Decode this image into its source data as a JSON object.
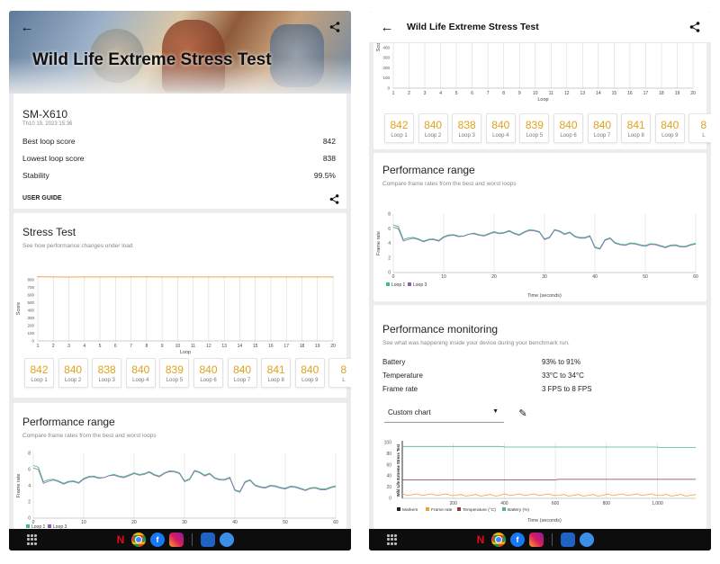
{
  "app": {
    "title": "Wild Life Extreme Stress Test",
    "back_icon": "arrow-left-icon",
    "share_icon": "share-icon"
  },
  "device": {
    "name": "SM-X610",
    "date": "Th10 19, 2023 15:36"
  },
  "summary": {
    "best_label": "Best loop score",
    "best_value": "842",
    "lowest_label": "Lowest loop score",
    "lowest_value": "838",
    "stability_label": "Stability",
    "stability_value": "99.5%",
    "user_guide": "USER GUIDE"
  },
  "stress": {
    "title": "Stress Test",
    "subtitle": "See how performance changes under load",
    "ylabel": "Score",
    "xlabel": "Loop",
    "ticks_left": [
      "800",
      "700",
      "600",
      "500",
      "400",
      "300",
      "200",
      "100",
      "0"
    ],
    "ticks_right": [
      "800",
      "700",
      "600",
      "500",
      "400",
      "300",
      "200",
      "100",
      "0"
    ]
  },
  "loops": [
    {
      "value": "842",
      "label": "Loop 1"
    },
    {
      "value": "840",
      "label": "Loop 2"
    },
    {
      "value": "838",
      "label": "Loop 3"
    },
    {
      "value": "840",
      "label": "Loop 4"
    },
    {
      "value": "839",
      "label": "Loop 5"
    },
    {
      "value": "840",
      "label": "Loop 6"
    },
    {
      "value": "840",
      "label": "Loop 7"
    },
    {
      "value": "841",
      "label": "Loop 8"
    },
    {
      "value": "840",
      "label": "Loop 9"
    },
    {
      "value": "8",
      "label": "L"
    }
  ],
  "perf_range": {
    "title": "Performance range",
    "subtitle": "Compare frame rates from the best and worst loops",
    "ylabel": "Frame rate",
    "xlabel": "Time (seconds)",
    "yticks": [
      "8",
      "6",
      "4",
      "2",
      "0"
    ],
    "xticks": [
      "0",
      "10",
      "20",
      "30",
      "40",
      "50",
      "60"
    ],
    "legend": [
      "Loop 1",
      "Loop 3"
    ],
    "colors": {
      "loop1": "#3dbf7a",
      "loop3": "#8a5fb5"
    }
  },
  "monitoring": {
    "title": "Performance monitoring",
    "subtitle": "See what was happening inside your device during your benchmark run.",
    "rows": [
      {
        "label": "Battery",
        "value": "93% to 91%"
      },
      {
        "label": "Temperature",
        "value": "33°C to 34°C"
      },
      {
        "label": "Frame rate",
        "value": "3 FPS to 8 FPS"
      }
    ],
    "dropdown": "Custom chart",
    "chart_vlabel": "Wild Life Extreme Stress Test",
    "yticks": [
      "100",
      "80",
      "60",
      "40",
      "20",
      "0"
    ],
    "xticks": [
      "200",
      "400",
      "600",
      "800",
      "1,000"
    ],
    "xlabel": "Time (seconds)",
    "legend": [
      "Markers",
      "Frame rate",
      "Temperature (°C)",
      "Battery (%)"
    ],
    "colors": {
      "markers": "#222222",
      "frame": "#f0a030",
      "temp": "#8b3a3a",
      "battery": "#4fb0a0"
    }
  },
  "navbar": {
    "apps": [
      "netflix-icon",
      "chrome-icon",
      "facebook-icon",
      "instagram-icon",
      "gallery-icon",
      "hub-icon"
    ],
    "netflix_glyph": "N",
    "facebook_glyph": "f"
  },
  "chart_data": [
    {
      "type": "line",
      "title": "Stress Test",
      "xlabel": "Loop",
      "ylabel": "Score",
      "x": [
        1,
        2,
        3,
        4,
        5,
        6,
        7,
        8,
        9,
        10,
        11,
        12,
        13,
        14,
        15,
        16,
        17,
        18,
        19,
        20
      ],
      "series": [
        {
          "values": [
            842,
            840,
            838,
            840,
            839,
            840,
            840,
            841,
            840,
            840,
            840,
            840,
            840,
            840,
            840,
            840,
            840,
            840,
            840,
            840
          ]
        }
      ],
      "ylim": [
        0,
        850
      ],
      "grid": "vertical"
    },
    {
      "type": "line",
      "title": "Performance range",
      "xlabel": "Time (seconds)",
      "ylabel": "Frame rate",
      "x": [
        0,
        2,
        4,
        6,
        8,
        10,
        12,
        14,
        16,
        18,
        20,
        22,
        24,
        26,
        28,
        30,
        32,
        34,
        36,
        38,
        40,
        42,
        44,
        46,
        48,
        50,
        52,
        54,
        56,
        58,
        60
      ],
      "series": [
        {
          "name": "Loop 1",
          "values": [
            6.5,
            4.5,
            4.8,
            4.3,
            4.6,
            4.9,
            5.2,
            5.0,
            5.4,
            5.1,
            5.6,
            5.5,
            5.4,
            5.6,
            5.8,
            4.6,
            5.9,
            5.3,
            5.0,
            4.8,
            3.5,
            4.5,
            4.1,
            3.8,
            4.0,
            3.7,
            3.9,
            3.5,
            3.8,
            3.6,
            4.0
          ]
        },
        {
          "name": "Loop 3",
          "values": [
            6.2,
            4.3,
            4.7,
            4.2,
            4.5,
            4.8,
            5.1,
            5.0,
            5.3,
            5.0,
            5.5,
            5.4,
            5.3,
            5.5,
            5.7,
            4.5,
            5.8,
            5.2,
            4.9,
            4.7,
            3.4,
            4.4,
            4.0,
            3.7,
            3.9,
            3.6,
            3.8,
            3.4,
            3.7,
            3.5,
            3.9
          ]
        }
      ],
      "ylim": [
        0,
        8
      ],
      "legend": "bottom-left"
    },
    {
      "type": "line",
      "title": "Wild Life Extreme Stress Test",
      "xlabel": "Time (seconds)",
      "x": [
        0,
        200,
        400,
        600,
        800,
        1000,
        1200
      ],
      "series": [
        {
          "name": "Frame rate",
          "values": [
            6,
            5,
            6,
            5,
            6,
            5,
            5
          ]
        },
        {
          "name": "Temperature (°C)",
          "values": [
            33,
            33,
            33,
            34,
            34,
            34,
            34
          ]
        },
        {
          "name": "Battery (%)",
          "values": [
            93,
            93,
            92,
            92,
            92,
            91,
            91
          ]
        }
      ],
      "ylim": [
        0,
        100
      ],
      "legend": "bottom"
    }
  ]
}
